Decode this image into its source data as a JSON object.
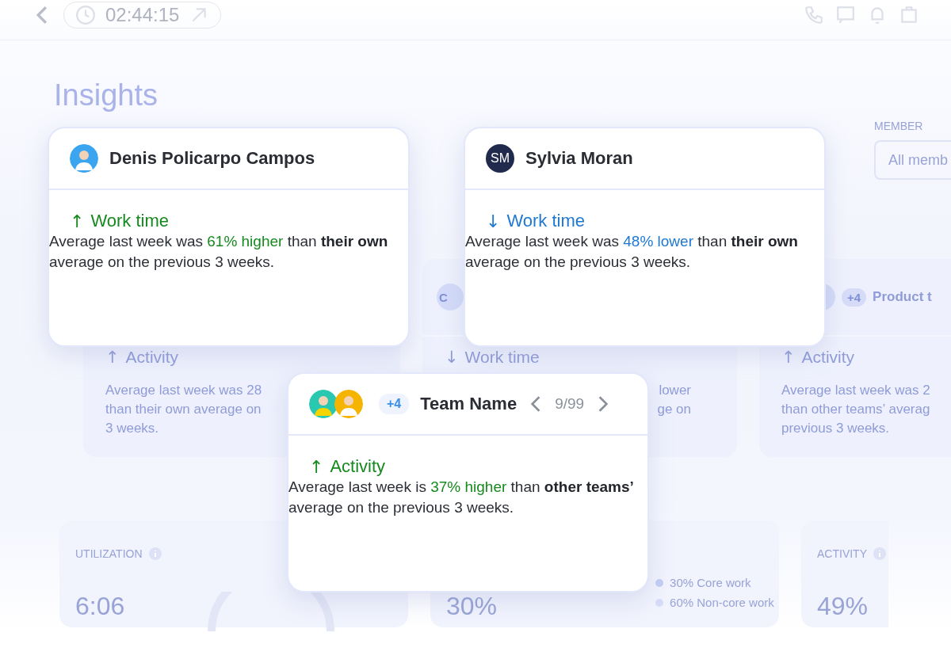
{
  "top_bar": {
    "time": "02:44:15"
  },
  "page_title": "Insights",
  "member_filter": {
    "label": "MEMBER",
    "value": "All memb"
  },
  "background_cards": [
    {
      "kind": "member",
      "metric": "Activity",
      "arrow": "↑",
      "body_lines": [
        "Average last week was 28",
        "than their own average on",
        "3 weeks."
      ]
    },
    {
      "kind": "member",
      "initials": "C",
      "metric": "Work time",
      "arrow": "↓",
      "body_lines": [
        "lower",
        "ge on"
      ]
    },
    {
      "kind": "team",
      "extra_count": "+4",
      "name": "Product t",
      "metric": "Activity",
      "arrow": "↑",
      "body_lines": [
        "Average last week was 2",
        "than other teams’ averag",
        "previous 3 weeks."
      ]
    }
  ],
  "stats": [
    {
      "kind": "gauge",
      "label": "UTILIZATION",
      "value": "6:06"
    },
    {
      "kind": "split",
      "value": "30%",
      "legend": [
        {
          "text": "30% Core work",
          "color": "#c5cdf5"
        },
        {
          "text": "60% Non-core work",
          "color": "#d6dcf8"
        }
      ]
    },
    {
      "kind": "plain",
      "label": "ACTIVITY",
      "value": "49%"
    }
  ],
  "insight_cards": [
    {
      "kind": "member",
      "name": "Denis Policarpo Campos",
      "metric": "Work time",
      "arrow": "↑",
      "color": "#178a1f",
      "before": "Average last week was ",
      "highlight": "61% higher",
      "after": " than **their own** average on the previous 3 weeks."
    },
    {
      "kind": "member",
      "initials": "SM",
      "name": "Sylvia Moran",
      "metric": "Work time",
      "arrow": "↓",
      "color": "#1f78d1",
      "before": "Average last week was ",
      "highlight": "48% lower",
      "after": " than **their own** average on the previous 3 weeks."
    },
    {
      "kind": "team",
      "extra_count": "+4",
      "name": "Team Name",
      "pager": "9/99",
      "metric": "Activity",
      "arrow": "↑",
      "color": "#178a1f",
      "before": "Average last week is ",
      "highlight": "37% higher",
      "after": " than **other teams’** average on the previous 3 weeks."
    }
  ]
}
